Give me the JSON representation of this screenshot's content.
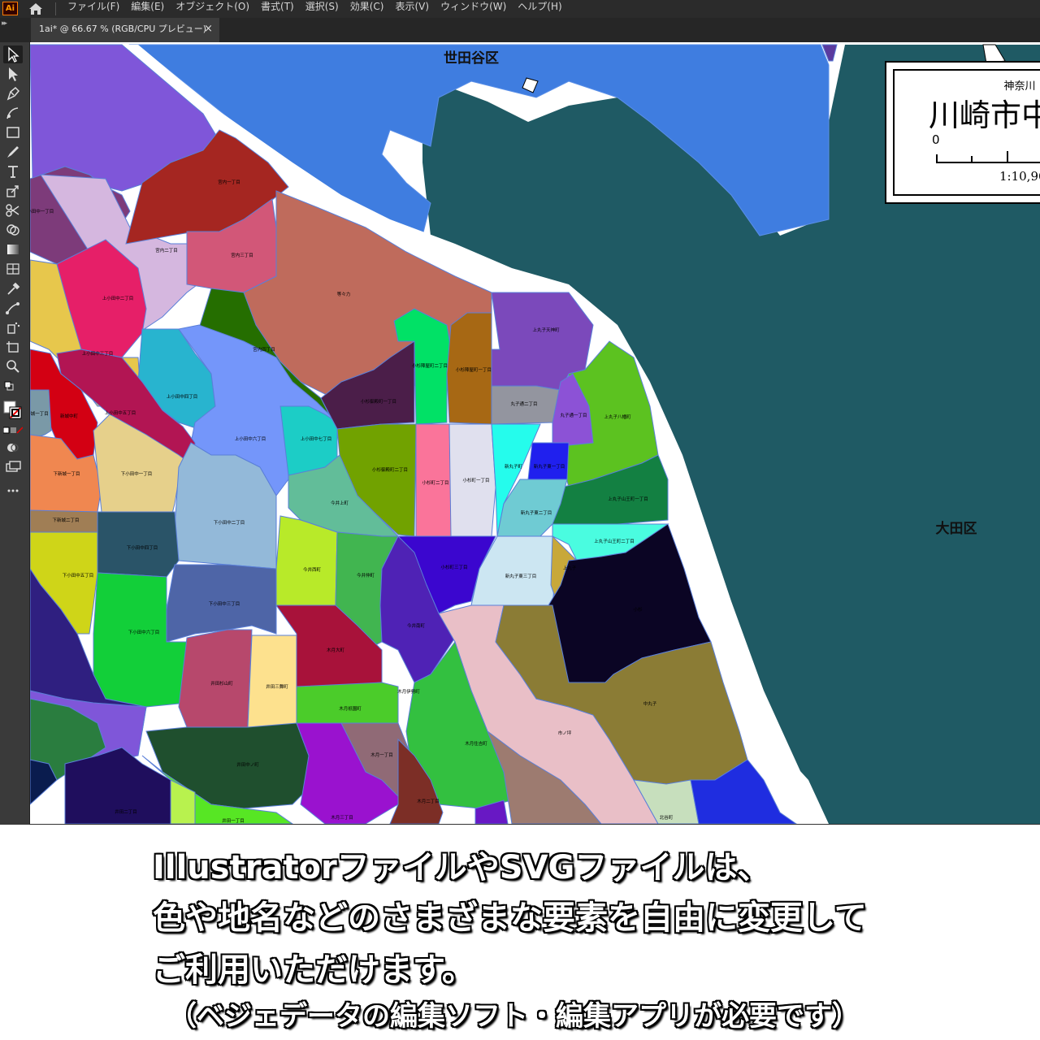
{
  "app": {
    "logo": "Ai",
    "menus": [
      "ファイル(F)",
      "編集(E)",
      "オブジェクト(O)",
      "書式(T)",
      "選択(S)",
      "効果(C)",
      "表示(V)",
      "ウィンドウ(W)",
      "ヘルプ(H)"
    ],
    "tab_title": "1ai* @ 66.67 % (RGB/CPU プレビュー)",
    "tab_close": "×"
  },
  "tools": [
    "selection-tool",
    "direct-selection-tool",
    "pen-tool",
    "curvature-tool",
    "rectangle-tool",
    "brush-tool",
    "type-tool",
    "scale-tool",
    "scissors-tool",
    "shape-builder-tool",
    "gradient-tool",
    "mesh-tool",
    "eyedropper-tool",
    "puppet-warp-tool",
    "symbol-sprayer-tool",
    "artboard-tool",
    "zoom-tool"
  ],
  "map": {
    "colors": {
      "water": "#1f5a64",
      "river": "#ffffff",
      "setagaya": "#3f7de0"
    },
    "ward_labels": {
      "setagaya": "世田谷区",
      "ota": "大田区"
    },
    "title_box": {
      "prefecture": "神奈川",
      "title": "川崎市中",
      "scale_zero": "0",
      "scale": "1:10,96"
    },
    "districts": {
      "miyauchi1": "宮内一丁目",
      "miyauchi2": "宮内二丁目",
      "miyauchi3": "宮内三丁目",
      "miyauchi4": "宮内四丁目",
      "todoroki": "等々力",
      "kamiodanaka1": "上小田中一丁目",
      "kamiodanaka2": "上小田中二丁目",
      "kamiodanaka3": "上小田中三丁目",
      "kamiodanaka4": "上小田中四丁目",
      "kamiodanaka5": "上小田中五丁目",
      "kamiodanaka6": "上小田中六丁目",
      "kamiodanaka7": "上小田中七丁目",
      "shinjo": "新城中町",
      "shinjo1": "新城一丁目",
      "shimoshinjo1": "下新城一丁目",
      "shimoshinjo2": "下新城二丁目",
      "shimoodanaka1": "下小田中一丁目",
      "shimoodanaka2": "下小田中二丁目",
      "shimoodanaka3": "下小田中三丁目",
      "shimoodanaka4": "下小田中四丁目",
      "shimoodanaka5": "下小田中五丁目",
      "shimoodanaka6": "下小田中六丁目",
      "kosugi_goten1": "小杉御殿町一丁目",
      "kosugi_goten2": "小杉御殿町二丁目",
      "kosugi_jinya1": "小杉陣屋町一丁目",
      "kosugi_jinya2": "小杉陣屋町二丁目",
      "kosugi1": "小杉町一丁目",
      "kosugi2": "小杉町二丁目",
      "kosugi3": "小杉町三丁目",
      "imaikami": "今井上町",
      "imainishi": "今井西町",
      "imaiminami": "今井南町",
      "imainaka": "今井仲町",
      "kizuki": "木月大町",
      "kizuki_gion": "木月祇園町",
      "kizuki_ise": "木月伊勢町",
      "kizuki_sumiyoshi": "木月住吉町",
      "kizuki1": "木月一丁目",
      "kizuki2": "木月二丁目",
      "kizuki3": "木月三丁目",
      "ida_sugiyama": "井田杉山町",
      "ida_sanmai": "井田三舞町",
      "ida_nakano": "井田中ノ町",
      "ida1": "井田一丁目",
      "ida2": "井田二丁目",
      "kamimaruko_tenno": "上丸子天神町",
      "kamimaruko_hachiman": "上丸子八幡町",
      "kamimaruko_sanno1": "上丸子山王町一丁目",
      "kamimaruko_sanno2": "上丸子山王町二丁目",
      "kamimaruko": "上丸子",
      "maruko_dori1": "丸子通一丁目",
      "maruko_dori2": "丸子通二丁目",
      "shinmaruko": "新丸子町",
      "shinmaruko_higashi1": "新丸子東一丁目",
      "shinmaruko_higashi2": "新丸子東二丁目",
      "shinmaruko_higashi3": "新丸子東三丁目",
      "nakamaruko": "中丸子",
      "kosugi": "小杉",
      "sannomiya": "市ノ坪",
      "kitaya": "北谷町"
    }
  },
  "caption": {
    "line1": "IllustratorファイルやSVGファイルは、",
    "line2": "色や地名などのさまざまな要素を自由に変更して",
    "line3": "ご利用いただけます。",
    "line4": "（ベジェデータの編集ソフト・編集アプリが必要です）"
  }
}
